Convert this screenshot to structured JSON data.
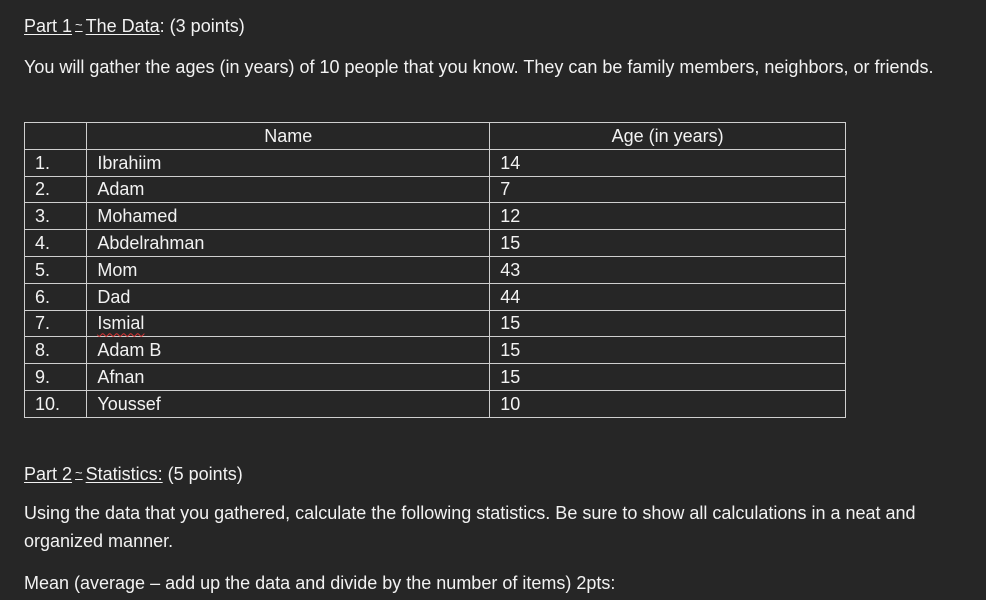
{
  "part1": {
    "label": "Part 1",
    "tilde": "~",
    "title": "The Data",
    "points": ": (3 points)"
  },
  "intro": "You will gather the ages (in years) of 10 people that you know.  They can be family members, neighbors, or friends.",
  "table": {
    "headers": [
      "",
      "Name",
      "Age (in years)"
    ],
    "rows": [
      {
        "num": "1.",
        "name": "Ibrahiim",
        "age": "14"
      },
      {
        "num": "2.",
        "name": "Adam",
        "age": "7"
      },
      {
        "num": "3.",
        "name": "Mohamed",
        "age": "12"
      },
      {
        "num": "4.",
        "name": "Abdelrahman",
        "age": "15"
      },
      {
        "num": "5.",
        "name": "Mom",
        "age": "43"
      },
      {
        "num": "6.",
        "name": "Dad",
        "age": "44"
      },
      {
        "num": "7.",
        "name": "Ismial",
        "age": "15"
      },
      {
        "num": "8.",
        "name": "Adam B",
        "age": "15"
      },
      {
        "num": "9.",
        "name": "Afnan",
        "age": "15"
      },
      {
        "num": "10.",
        "name": "Youssef",
        "age": "10"
      }
    ]
  },
  "part2": {
    "label": "Part 2",
    "tilde": "~",
    "title": "Statistics:",
    "points": " (5 points)"
  },
  "instructions": "Using the data that you gathered, calculate the following statistics.  Be sure to show all calculations in a neat and organized manner.",
  "mean_prompt": "Mean (average – add up the data and divide by the number of items) 2pts:"
}
